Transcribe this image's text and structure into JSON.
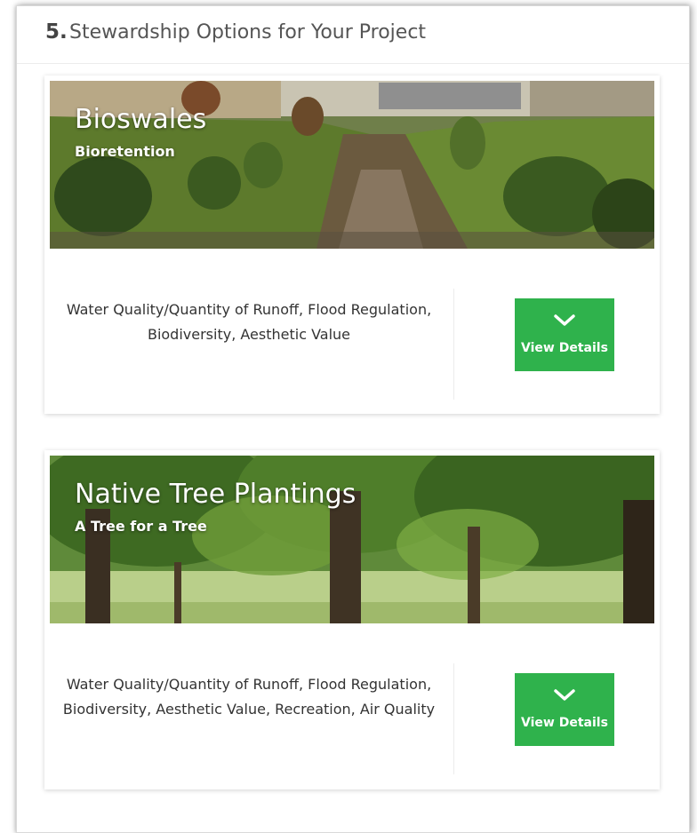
{
  "section": {
    "number": "5.",
    "title": "Stewardship Options for Your Project"
  },
  "cards": [
    {
      "title": "Bioswales",
      "subtitle": "Bioretention",
      "benefits": "Water Quality/Quantity of Runoff, Flood Regulation, Biodiversity, Aesthetic Value",
      "button_label": "View Details",
      "button_icon": "chevron-down-icon"
    },
    {
      "title": "Native Tree Plantings",
      "subtitle": "A Tree for a Tree",
      "benefits": "Water Quality/Quantity of Runoff, Flood Regulation, Biodiversity, Aesthetic Value, Recreation, Air Quality",
      "button_label": "View Details",
      "button_icon": "chevron-down-icon"
    }
  ],
  "colors": {
    "button": "#2fb24c",
    "border": "#d9d9d9"
  }
}
